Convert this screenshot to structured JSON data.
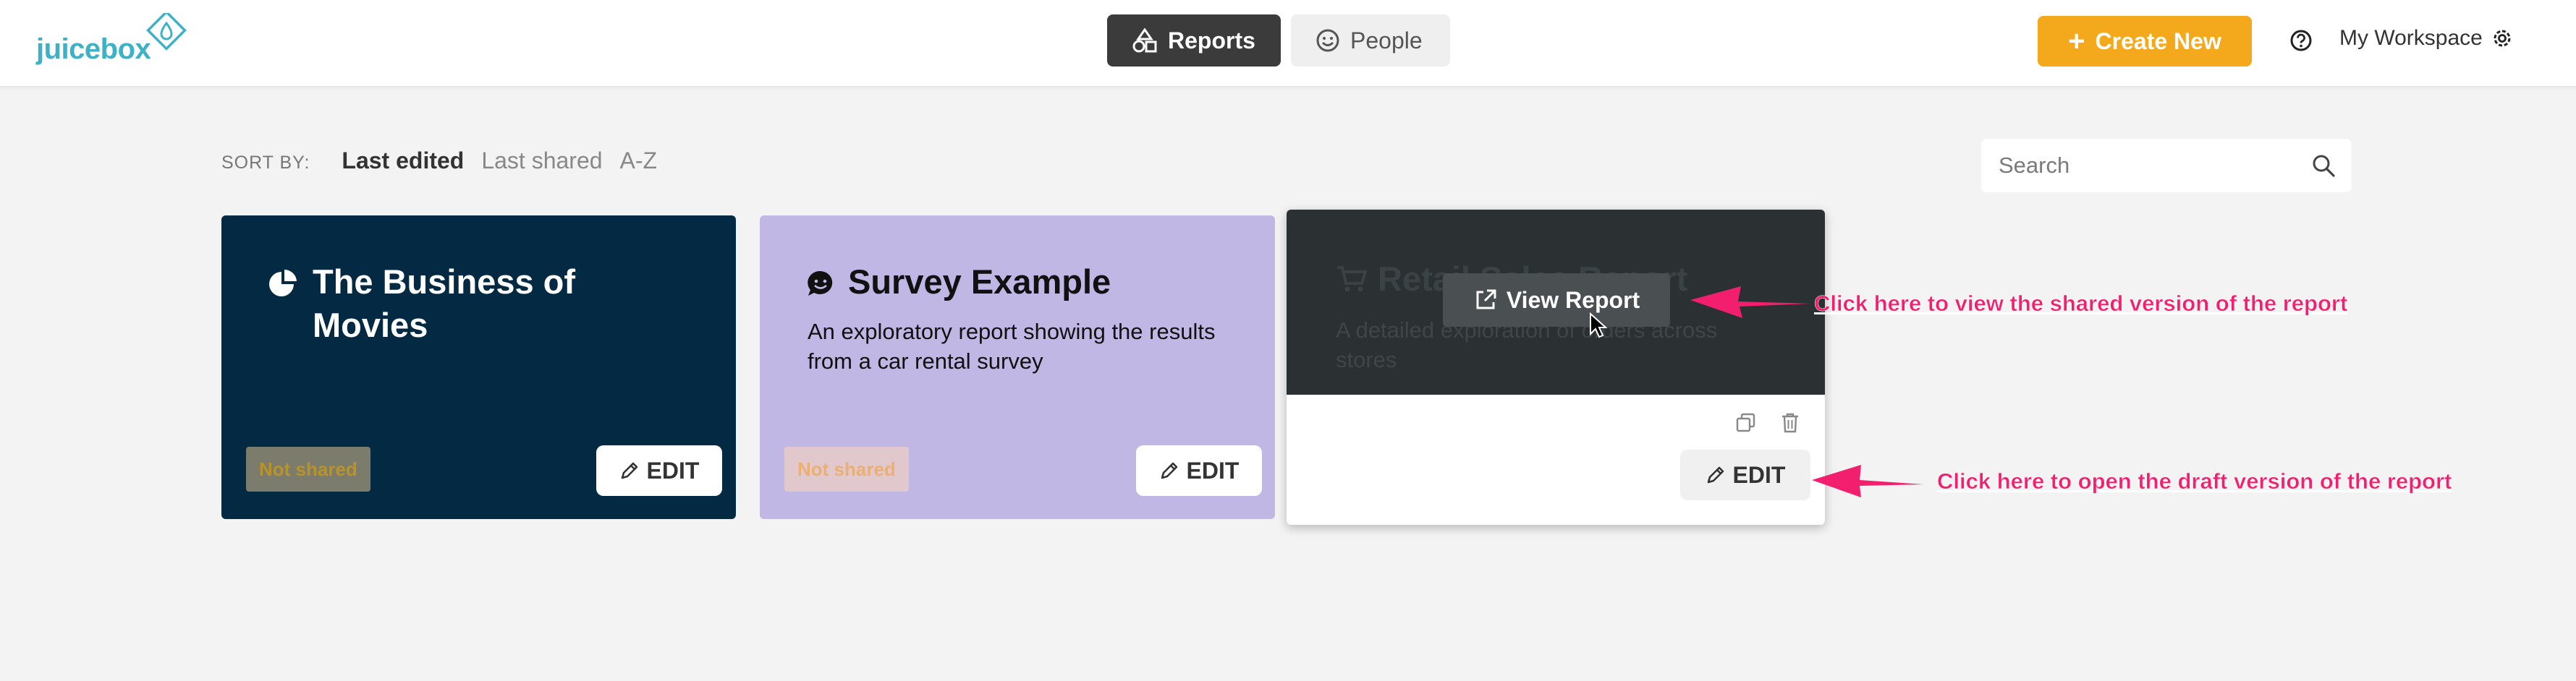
{
  "header": {
    "logo_text": "juicebox",
    "nav": [
      {
        "label": "Reports",
        "active": true,
        "icon": "shapes-icon"
      },
      {
        "label": "People",
        "active": false,
        "icon": "smiley-icon"
      }
    ],
    "create_label": "Create New",
    "workspace_label": "My Workspace"
  },
  "sort": {
    "label": "SORT BY:",
    "options": [
      {
        "label": "Last edited",
        "active": true
      },
      {
        "label": "Last shared",
        "active": false
      },
      {
        "label": "A-Z",
        "active": false
      }
    ]
  },
  "search": {
    "placeholder": "Search",
    "value": ""
  },
  "reports": [
    {
      "title": "The Business of Movies",
      "description": "",
      "status": "Not shared",
      "edit_label": "EDIT",
      "icon": "pie-chart-icon",
      "bg_color": "#042942"
    },
    {
      "title": "Survey Example",
      "description": "An exploratory report showing the results from a car rental survey",
      "status": "Not shared",
      "edit_label": "EDIT",
      "icon": "chat-smiley-icon",
      "bg_color": "#c0b7e5"
    },
    {
      "title": "Retail Sales Report",
      "description": "A detailed exploration of orders across stores",
      "view_label": "View Report",
      "edit_label": "EDIT",
      "icon": "cart-icon",
      "bg_color": "#2b3133"
    }
  ],
  "annotations": {
    "view": "Click here to view the shared version of the report",
    "edit": "Click here to open the draft version of the report"
  },
  "colors": {
    "accent": "#f4a81c",
    "brand": "#3fb1c6",
    "annotation": "#f21f6e"
  }
}
